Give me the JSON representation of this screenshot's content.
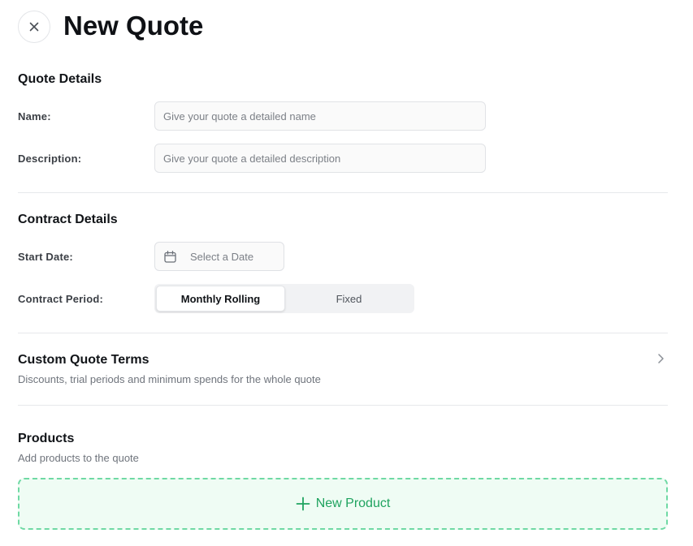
{
  "header": {
    "title": "New Quote",
    "close_icon": "close-icon"
  },
  "quote_details": {
    "title": "Quote Details",
    "name_label": "Name:",
    "name_placeholder": "Give your quote a detailed name",
    "name_value": "",
    "description_label": "Description:",
    "description_placeholder": "Give your quote a detailed description",
    "description_value": ""
  },
  "contract_details": {
    "title": "Contract Details",
    "start_date_label": "Start Date:",
    "start_date_button": "Select a Date",
    "start_date_icon": "calendar-icon",
    "period_label": "Contract Period:",
    "period_options": [
      "Monthly Rolling",
      "Fixed"
    ],
    "period_selected": "Monthly Rolling"
  },
  "custom_terms": {
    "title": "Custom Quote Terms",
    "subtitle": "Discounts, trial periods and minimum spends for the whole quote",
    "icon": "chevron-right-icon"
  },
  "products": {
    "title": "Products",
    "subtitle": "Add products to the quote",
    "new_button": "New Product",
    "new_icon": "plus-icon"
  },
  "colors": {
    "accent_green": "#1fa35f",
    "dashed_border": "#6fd9a4",
    "dropzone_bg": "#effcf4"
  }
}
